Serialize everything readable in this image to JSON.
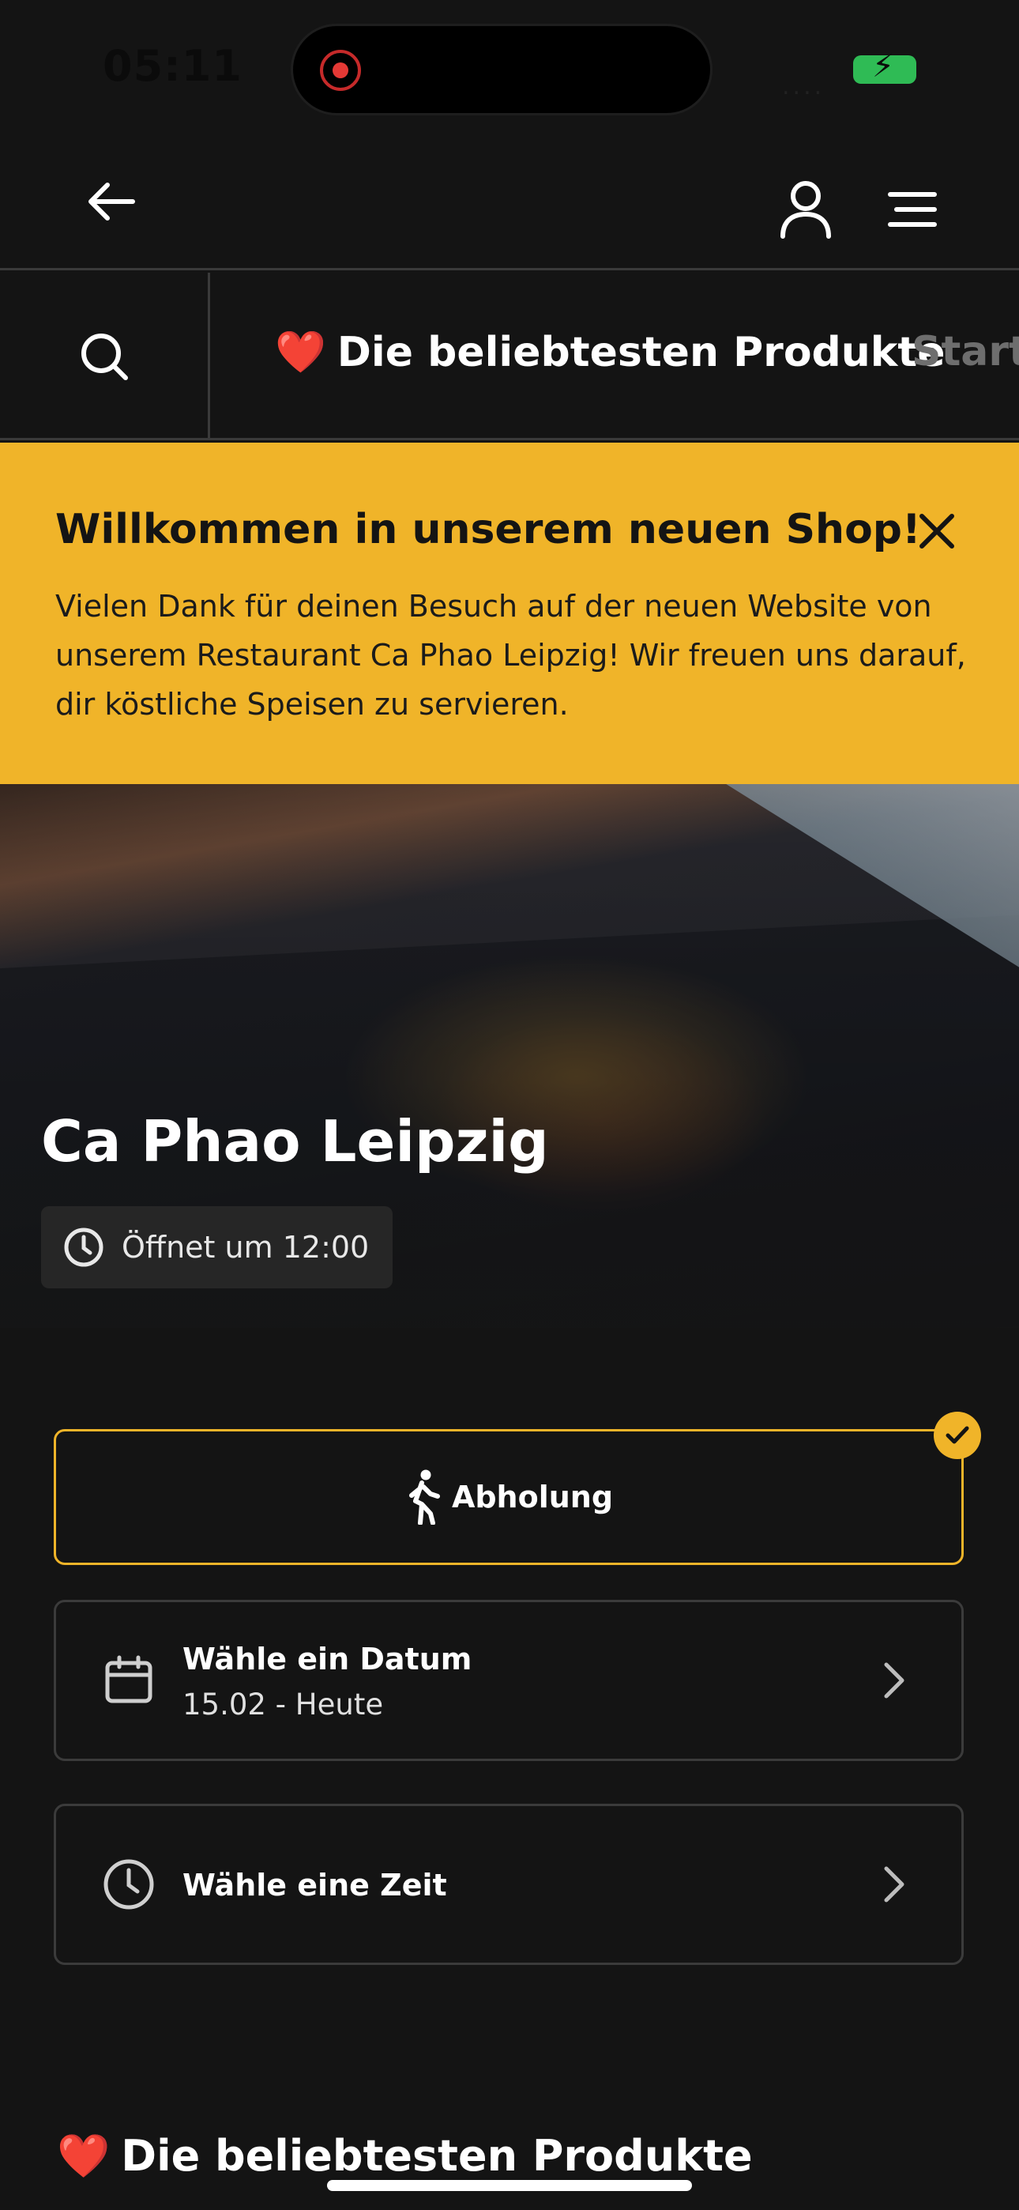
{
  "status_bar": {
    "time": "05:11",
    "signal": "....",
    "icons": [
      "screen-recording-icon",
      "signal-icon",
      "battery-charging-icon"
    ],
    "battery_color": "#2fbb55"
  },
  "nav": {
    "icons": [
      "arrow-left-icon",
      "user-icon",
      "menu-icon"
    ]
  },
  "categories": {
    "search_icon": "search-icon",
    "items": [
      {
        "emoji": "❤️",
        "label": "Die beliebtesten Produkte",
        "active": true
      },
      {
        "emoji": "",
        "label": "Starte",
        "active": false
      }
    ]
  },
  "banner": {
    "title": "Willkommen in unserem neuen Shop!",
    "text": "Vielen Dank für deinen Besuch auf der neuen Website von unserem Restaurant Ca Phao Leipzig! Wir freuen uns darauf, dir köstliche Speisen zu servieren.",
    "background": "#f0b429",
    "close_icon": "close-icon"
  },
  "hero": {
    "restaurant_name": "Ca Phao Leipzig",
    "opening_status": "Öffnet um 12:00",
    "clock_icon": "clock-icon"
  },
  "order": {
    "pickup": {
      "label": "Abholung",
      "icon": "walking-person-icon",
      "selected": true
    },
    "date": {
      "label": "Wähle ein Datum",
      "value": "15.02 - Heute",
      "icon": "calendar-icon"
    },
    "time": {
      "label": "Wähle eine Zeit",
      "icon": "clock-icon"
    },
    "accent": "#f0b429"
  },
  "section": {
    "emoji": "❤️",
    "title": "Die beliebtesten Produkte"
  }
}
